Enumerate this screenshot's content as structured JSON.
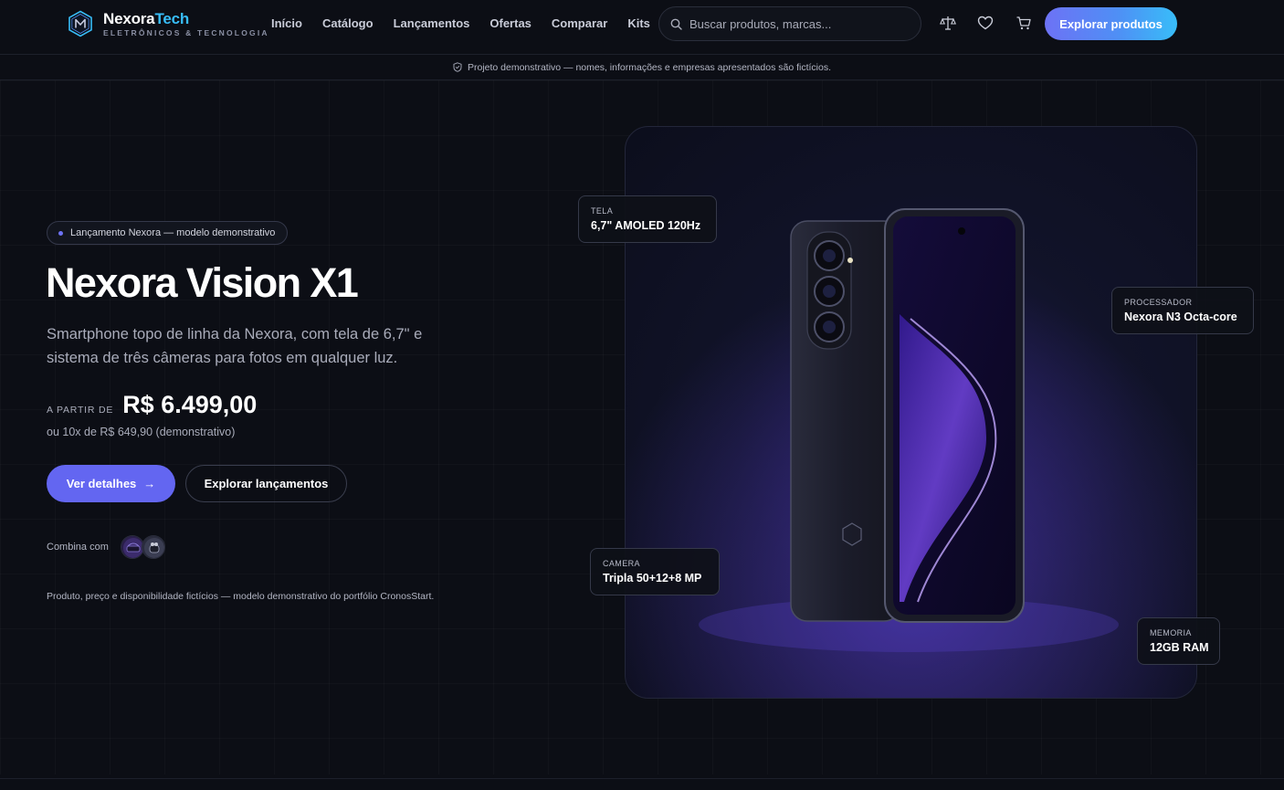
{
  "brand": {
    "name_part1": "Nexora",
    "name_part2": "Tech",
    "tagline": "ELETRÔNICOS & TECNOLOGIA",
    "logo_icon": "m-hexagon-logo"
  },
  "nav": {
    "items": [
      {
        "label": "Início"
      },
      {
        "label": "Catálogo"
      },
      {
        "label": "Lançamentos"
      },
      {
        "label": "Ofertas"
      },
      {
        "label": "Comparar"
      },
      {
        "label": "Kits"
      }
    ]
  },
  "search": {
    "placeholder": "Buscar produtos, marcas...",
    "icon": "search-icon"
  },
  "header_icons": [
    "compare-scale-icon",
    "heart-icon",
    "cart-icon"
  ],
  "header_cta": "Explorar produtos",
  "notice": {
    "text": "Projeto demonstrativo — nomes, informações e empresas apresentados são fictícios.",
    "icon": "shield-check-icon"
  },
  "hero": {
    "badge": "Lançamento Nexora — modelo demonstrativo",
    "title": "Nexora Vision X1",
    "description": "Smartphone topo de linha da Nexora, com tela de 6,7\" e sistema de três câmeras para fotos em qualquer luz.",
    "price_prefix": "A PARTIR DE",
    "price": "R$ 6.499,00",
    "installments": "ou 10x de R$ 649,90 (demonstrativo)",
    "primary_button": "Ver detalhes",
    "secondary_button": "Explorar lançamentos",
    "combo_label": "Combina com",
    "disclaimer": "Produto, preço e disponibilidade fictícios — modelo demonstrativo do portfólio CronosStart."
  },
  "specs": {
    "screen": {
      "label": "TELA",
      "value": "6,7\" AMOLED 120Hz"
    },
    "processor": {
      "label": "PROCESSADOR",
      "value": "Nexora N3 Octa-core"
    },
    "camera": {
      "label": "CAMERA",
      "value": "Tripla 50+12+8 MP"
    },
    "memory": {
      "label": "MEMORIA",
      "value": "12GB RAM"
    }
  },
  "colors": {
    "background": "#0c0e15",
    "accent": "#6366f1",
    "brand_cyan": "#38bdf8",
    "cta_gradient_start": "#6d72f5",
    "cta_gradient_end": "#38bdf8"
  }
}
